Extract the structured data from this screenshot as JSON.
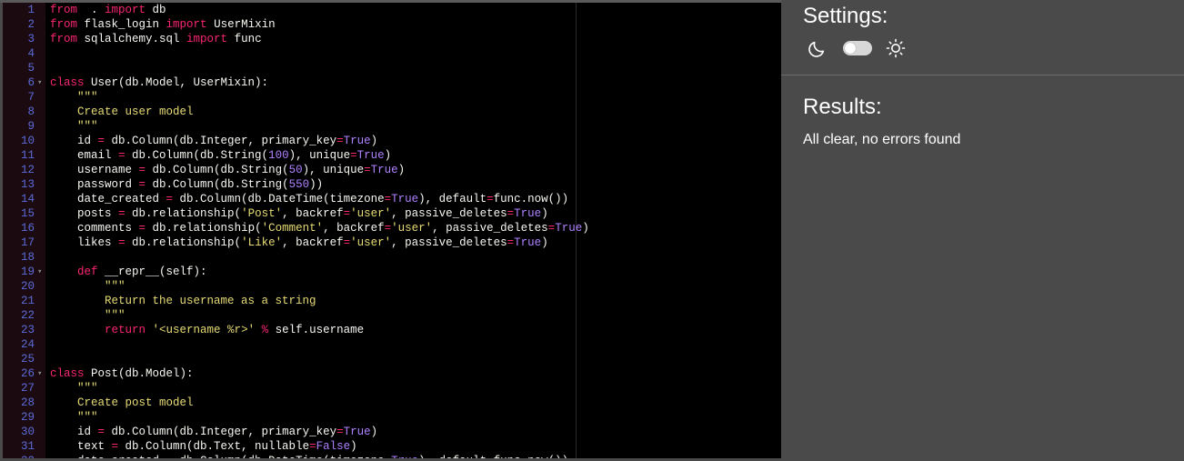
{
  "settings": {
    "title": "Settings:",
    "theme": "dark"
  },
  "results": {
    "title": "Results:",
    "message": "All clear, no errors found"
  },
  "editor": {
    "first_line": 1,
    "fold_lines": [
      6,
      19,
      26
    ],
    "lines": [
      [
        [
          "kw",
          "from"
        ],
        [
          "",
          "  . "
        ],
        [
          "kw",
          "import"
        ],
        [
          "",
          " db"
        ]
      ],
      [
        [
          "kw",
          "from"
        ],
        [
          "",
          " flask_login "
        ],
        [
          "kw",
          "import"
        ],
        [
          "",
          " UserMixin"
        ]
      ],
      [
        [
          "kw",
          "from"
        ],
        [
          "",
          " sqlalchemy.sql "
        ],
        [
          "kw",
          "import"
        ],
        [
          "",
          " func"
        ]
      ],
      [],
      [],
      [
        [
          "kw",
          "class"
        ],
        [
          "",
          " User(db.Model, UserMixin):"
        ]
      ],
      [
        [
          "str",
          "    \"\"\""
        ]
      ],
      [
        [
          "str",
          "    Create user model"
        ]
      ],
      [
        [
          "str",
          "    \"\"\""
        ]
      ],
      [
        [
          "",
          "    id "
        ],
        [
          "kw",
          "="
        ],
        [
          "",
          " db.Column(db.Integer, primary_key"
        ],
        [
          "kw",
          "="
        ],
        [
          "num",
          "True"
        ],
        [
          ")"
        ]
      ],
      [
        [
          "",
          "    email "
        ],
        [
          "kw",
          "="
        ],
        [
          "",
          " db.Column(db.String("
        ],
        [
          "num",
          "100"
        ],
        [
          "",
          "), unique"
        ],
        [
          "kw",
          "="
        ],
        [
          "num",
          "True"
        ],
        [
          "",
          ")"
        ]
      ],
      [
        [
          "",
          "    username "
        ],
        [
          "kw",
          "="
        ],
        [
          "",
          " db.Column(db.String("
        ],
        [
          "num",
          "50"
        ],
        [
          "",
          "), unique"
        ],
        [
          "kw",
          "="
        ],
        [
          "num",
          "True"
        ],
        [
          "",
          ")"
        ]
      ],
      [
        [
          "",
          "    password "
        ],
        [
          "kw",
          "="
        ],
        [
          "",
          " db.Column(db.String("
        ],
        [
          "num",
          "550"
        ],
        [
          "",
          "))"
        ]
      ],
      [
        [
          "",
          "    date_created "
        ],
        [
          "kw",
          "="
        ],
        [
          "",
          " db.Column(db.DateTime(timezone"
        ],
        [
          "kw",
          "="
        ],
        [
          "num",
          "True"
        ],
        [
          "",
          "), default"
        ],
        [
          "kw",
          "="
        ],
        [
          "",
          "func.now())"
        ]
      ],
      [
        [
          "",
          "    posts "
        ],
        [
          "kw",
          "="
        ],
        [
          "",
          " db.relationship("
        ],
        [
          "str",
          "'Post'"
        ],
        [
          "",
          ", backref"
        ],
        [
          "kw",
          "="
        ],
        [
          "str",
          "'user'"
        ],
        [
          "",
          ", passive_deletes"
        ],
        [
          "kw",
          "="
        ],
        [
          "num",
          "True"
        ],
        [
          "",
          ")"
        ]
      ],
      [
        [
          "",
          "    comments "
        ],
        [
          "kw",
          "="
        ],
        [
          "",
          " db.relationship("
        ],
        [
          "str",
          "'Comment'"
        ],
        [
          "",
          ", backref"
        ],
        [
          "kw",
          "="
        ],
        [
          "str",
          "'user'"
        ],
        [
          "",
          ", passive_deletes"
        ],
        [
          "kw",
          "="
        ],
        [
          "num",
          "True"
        ],
        [
          "",
          ")"
        ]
      ],
      [
        [
          "",
          "    likes "
        ],
        [
          "kw",
          "="
        ],
        [
          "",
          " db.relationship("
        ],
        [
          "str",
          "'Like'"
        ],
        [
          "",
          ", backref"
        ],
        [
          "kw",
          "="
        ],
        [
          "str",
          "'user'"
        ],
        [
          "",
          ", passive_deletes"
        ],
        [
          "kw",
          "="
        ],
        [
          "num",
          "True"
        ],
        [
          "",
          ")"
        ]
      ],
      [],
      [
        [
          "",
          "    "
        ],
        [
          "kw",
          "def"
        ],
        [
          "",
          " __repr__(self):"
        ]
      ],
      [
        [
          "str",
          "        \"\"\""
        ]
      ],
      [
        [
          "str",
          "        Return the username as a string"
        ]
      ],
      [
        [
          "str",
          "        \"\"\""
        ]
      ],
      [
        [
          "",
          "        "
        ],
        [
          "kw",
          "return"
        ],
        [
          "",
          " "
        ],
        [
          "str",
          "'<username %r>'"
        ],
        [
          "",
          " "
        ],
        [
          "kw",
          "%"
        ],
        [
          "",
          " self.username"
        ]
      ],
      [],
      [],
      [
        [
          "kw",
          "class"
        ],
        [
          "",
          " Post(db.Model):"
        ]
      ],
      [
        [
          "str",
          "    \"\"\""
        ]
      ],
      [
        [
          "str",
          "    Create post model"
        ]
      ],
      [
        [
          "str",
          "    \"\"\""
        ]
      ],
      [
        [
          "",
          "    id "
        ],
        [
          "kw",
          "="
        ],
        [
          "",
          " db.Column(db.Integer, primary_key"
        ],
        [
          "kw",
          "="
        ],
        [
          "num",
          "True"
        ],
        [
          "",
          ")"
        ]
      ],
      [
        [
          "",
          "    text "
        ],
        [
          "kw",
          "="
        ],
        [
          "",
          " db.Column(db.Text, nullable"
        ],
        [
          "kw",
          "="
        ],
        [
          "num",
          "False"
        ],
        [
          "",
          ")"
        ]
      ],
      [
        [
          "",
          "    date_created "
        ],
        [
          "kw",
          "="
        ],
        [
          "",
          " db.Column(db.DateTime(timezone"
        ],
        [
          "kw",
          "="
        ],
        [
          "num",
          "True"
        ],
        [
          "",
          "), default"
        ],
        [
          "kw",
          "="
        ],
        [
          "",
          "func.now())"
        ]
      ]
    ]
  }
}
